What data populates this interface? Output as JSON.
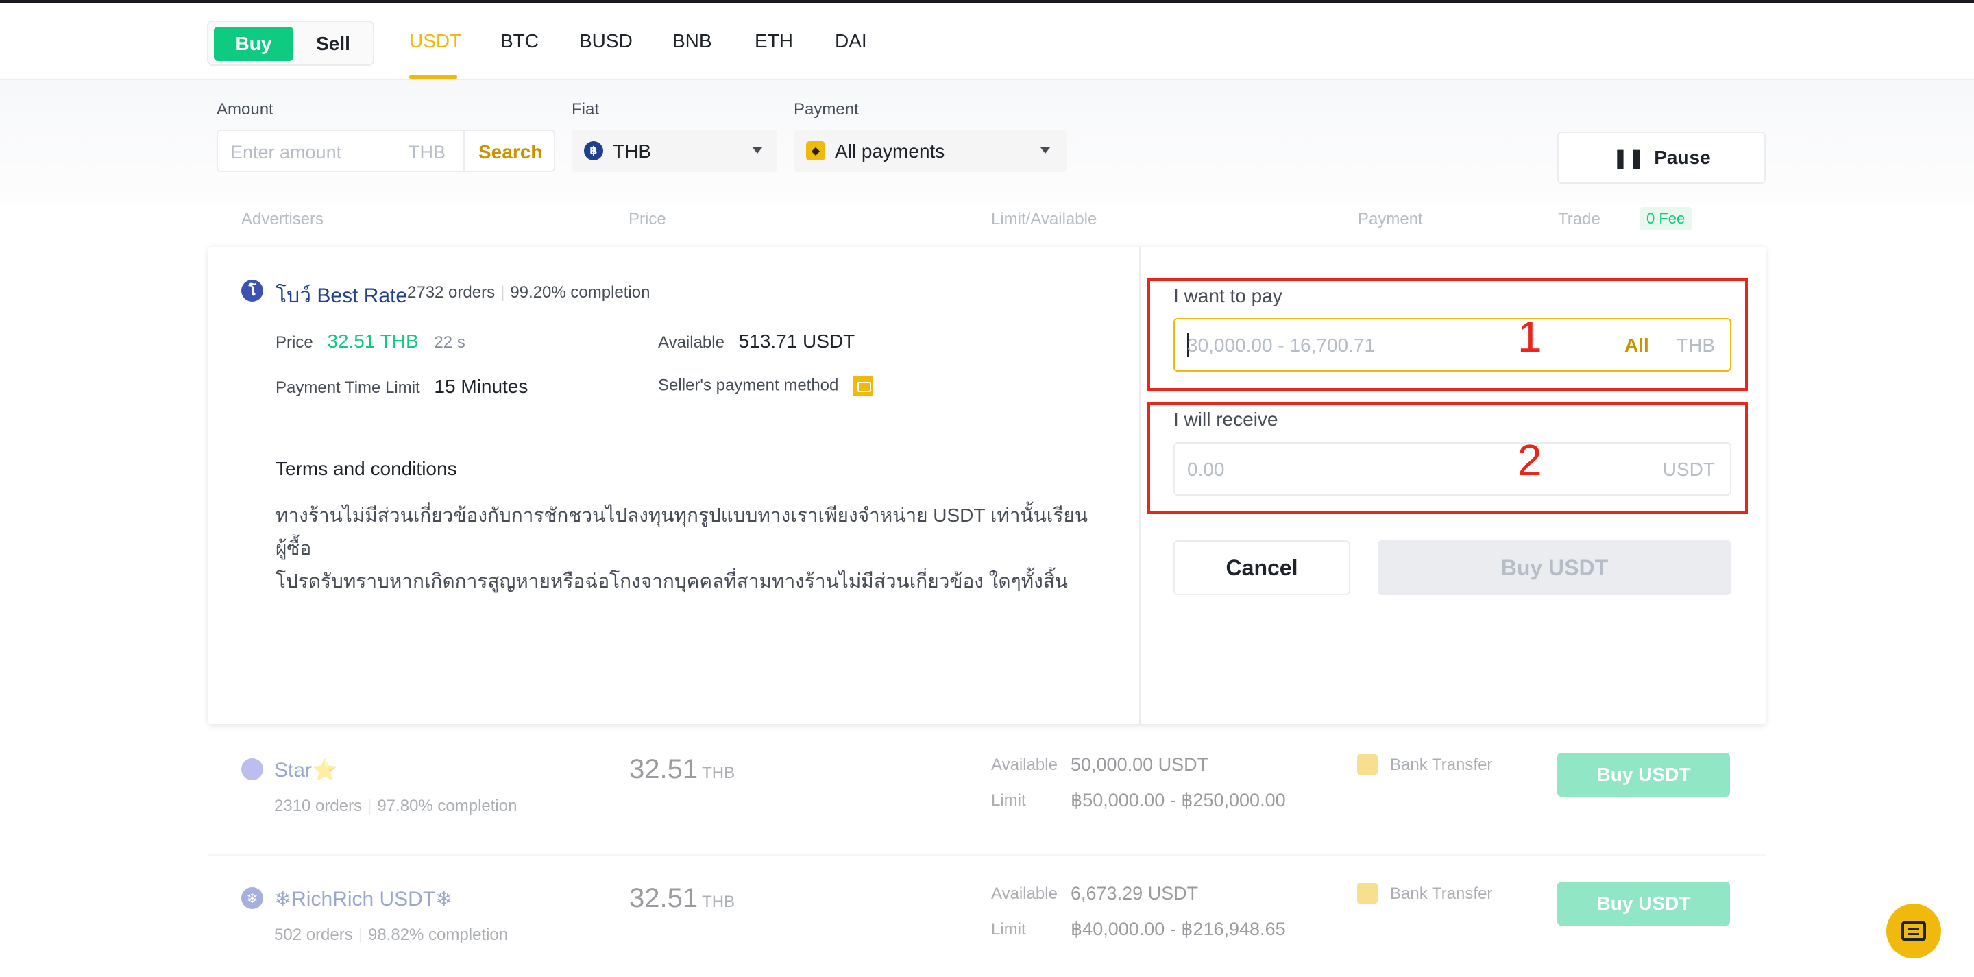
{
  "topbar": {
    "buy_label": "Buy",
    "sell_label": "Sell",
    "assets": [
      "USDT",
      "BTC",
      "BUSD",
      "BNB",
      "ETH",
      "DAI"
    ],
    "active_asset": "USDT"
  },
  "filters": {
    "amount_label": "Amount",
    "amount_placeholder": "Enter amount",
    "amount_currency": "THB",
    "search_label": "Search",
    "fiat_label": "Fiat",
    "fiat_value": "THB",
    "payment_label": "Payment",
    "payment_value": "All payments",
    "pause_label": "Pause"
  },
  "columns": {
    "advertisers": "Advertisers",
    "price": "Price",
    "limit": "Limit/Available",
    "payment": "Payment",
    "trade": "Trade",
    "fee_badge": "0 Fee"
  },
  "expanded": {
    "avatar_letter": "โ",
    "name": "โบว์ Best Rate",
    "orders": "2732 orders",
    "completion": "99.20% completion",
    "price_label": "Price",
    "price_value": "32.51 THB",
    "price_timer": "22 s",
    "available_label": "Available",
    "available_value": "513.71 USDT",
    "time_limit_label": "Payment Time Limit",
    "time_limit_value": "15 Minutes",
    "seller_method_label": "Seller's payment method",
    "terms_title": "Terms and conditions",
    "terms_line1": "ทางร้านไม่มีส่วนเกี่ยวข้องกับการชักชวนไปลงทุนทุกรูปแบบทางเราเพียงจำหน่าย USDT เท่านั้นเรียนผู้ซื้อ",
    "terms_line2": "โปรดรับทราบหากเกิดการสูญหายหรือฉ่อโกงจากบุคคลที่สามทางร้านไม่มีส่วนเกี่ยวข้อง ใดๆทั้งสิ้น",
    "pay_label": "I want to pay",
    "pay_placeholder": "30,000.00 - 16,700.71",
    "pay_all": "All",
    "pay_currency": "THB",
    "receive_label": "I will receive",
    "receive_placeholder": "0.00",
    "receive_currency": "USDT",
    "cancel_label": "Cancel",
    "buy_label": "Buy USDT",
    "annotation_1": "1",
    "annotation_2": "2"
  },
  "rows": [
    {
      "avatar_letter": "",
      "name": "Star⭐",
      "orders": "2310 orders",
      "completion": "97.80% completion",
      "price": "32.51",
      "price_unit": "THB",
      "available_label": "Available",
      "available": "50,000.00 USDT",
      "limit_label": "Limit",
      "limit": "฿50,000.00 - ฿250,000.00",
      "payment": "Bank Transfer",
      "buy_label": "Buy USDT"
    },
    {
      "avatar_letter": "❄",
      "name": "❄RichRich USDT❄",
      "orders": "502 orders",
      "completion": "98.82% completion",
      "price": "32.51",
      "price_unit": "THB",
      "available_label": "Available",
      "available": "6,673.29 USDT",
      "limit_label": "Limit",
      "limit": "฿40,000.00 - ฿216,948.65",
      "payment": "Bank Transfer",
      "buy_label": "Buy USDT"
    }
  ],
  "colors": {
    "accent": "#f0b90b",
    "buy_green": "#0ecb81",
    "annotation_red": "#e8261c"
  }
}
